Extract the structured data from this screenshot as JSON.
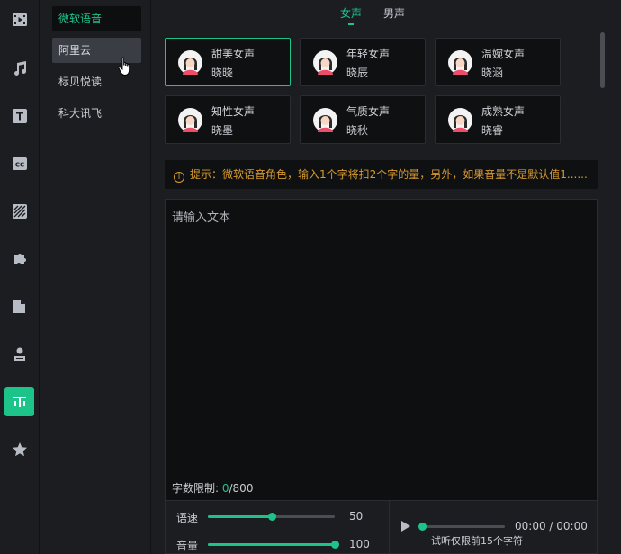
{
  "rail": {
    "icons": [
      "media-icon",
      "music-icon",
      "text-icon",
      "caption-icon",
      "filter-icon",
      "puzzle-icon",
      "folder-icon",
      "person-icon",
      "tts-icon",
      "star-icon"
    ],
    "active": "tts-icon",
    "accent": "#1cc48a"
  },
  "providers": {
    "items": [
      {
        "label": "微软语音",
        "state": "active"
      },
      {
        "label": "阿里云",
        "state": "hover"
      },
      {
        "label": "标贝悦读",
        "state": "normal"
      },
      {
        "label": "科大讯飞",
        "state": "normal"
      }
    ]
  },
  "gender_tabs": [
    {
      "label": "女声",
      "active": true
    },
    {
      "label": "男声",
      "active": false
    }
  ],
  "voices": [
    {
      "name": "甜美女声",
      "sub": "晓晓",
      "selected": true
    },
    {
      "name": "年轻女声",
      "sub": "晓辰",
      "selected": false
    },
    {
      "name": "温婉女声",
      "sub": "晓涵",
      "selected": false
    },
    {
      "name": "知性女声",
      "sub": "晓墨",
      "selected": false
    },
    {
      "name": "气质女声",
      "sub": "晓秋",
      "selected": false
    },
    {
      "name": "成熟女声",
      "sub": "晓睿",
      "selected": false
    }
  ],
  "tip": {
    "icon": "info-icon",
    "text": "提示：微软语音角色，输入1个字将扣2个字的量，另外，如果音量不是默认值1......"
  },
  "editor": {
    "placeholder": "请输入文本",
    "count_label": "字数限制: ",
    "count_used": "0",
    "count_max": "/800"
  },
  "controls": {
    "speed": {
      "label": "语速",
      "value": "50",
      "fraction": 0.5
    },
    "volume": {
      "label": "音量",
      "value": "100",
      "fraction": 1.0
    },
    "player": {
      "time": "00:00 / 00:00",
      "note": "试听仅限前15个字符",
      "progress": 0
    }
  }
}
